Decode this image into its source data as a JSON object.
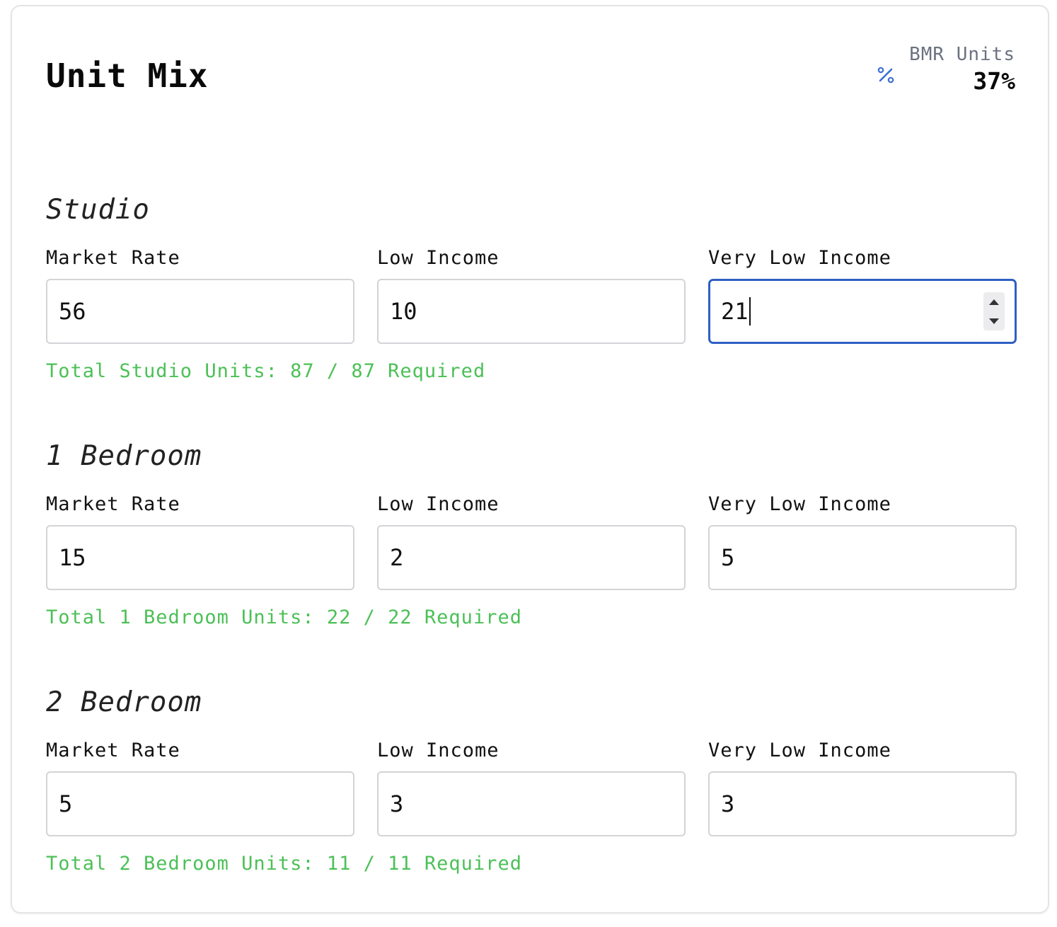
{
  "header": {
    "title": "Unit Mix",
    "stat_label": "BMR Units",
    "stat_value": "37%",
    "stat_icon": "percent-icon",
    "accent_color": "#3b6fd6"
  },
  "sections": [
    {
      "title": "Studio",
      "fields": [
        {
          "label": "Market Rate",
          "value": "56"
        },
        {
          "label": "Low Income",
          "value": "10"
        },
        {
          "label": "Very Low Income",
          "value": "21"
        }
      ],
      "total": "Total Studio Units: 87 / 87 Required"
    },
    {
      "title": "1 Bedroom",
      "fields": [
        {
          "label": "Market Rate",
          "value": "15"
        },
        {
          "label": "Low Income",
          "value": "2"
        },
        {
          "label": "Very Low Income",
          "value": "5"
        }
      ],
      "total": "Total 1 Bedroom Units: 22 / 22 Required"
    },
    {
      "title": "2 Bedroom",
      "fields": [
        {
          "label": "Market Rate",
          "value": "5"
        },
        {
          "label": "Low Income",
          "value": "3"
        },
        {
          "label": "Very Low Income",
          "value": "3"
        }
      ],
      "total": "Total 2 Bedroom Units: 11 / 11 Required"
    }
  ],
  "colors": {
    "success": "#4cc057",
    "focus_border": "#2f5fc4",
    "muted_text": "#6b7280"
  }
}
